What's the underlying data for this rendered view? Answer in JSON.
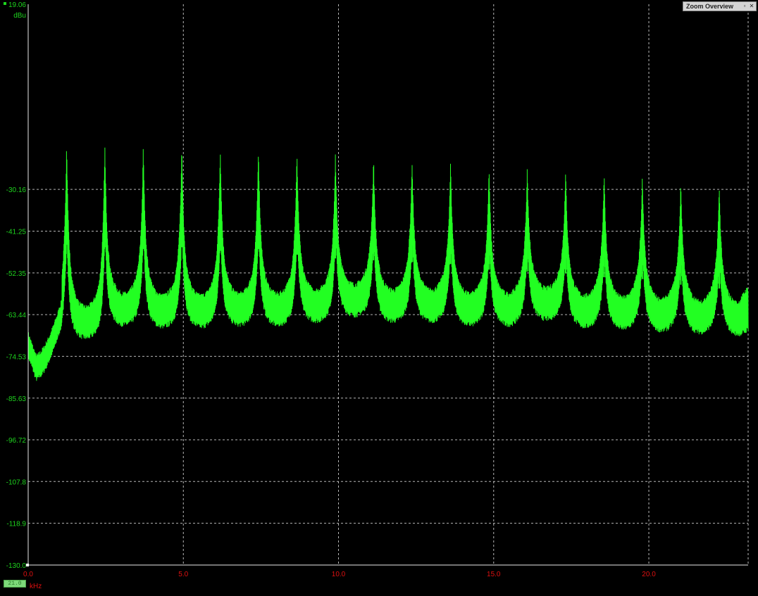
{
  "window": {
    "panel_title": "Zoom Overview",
    "restore_glyph": "▫",
    "close_glyph": "✕",
    "status_chip": "21.0"
  },
  "colors": {
    "background": "#000000",
    "trace": "#22ff22",
    "y_labels": "#1ed41e",
    "x_labels": "#e01010",
    "grid": "#d8d8d8"
  },
  "chart_data": {
    "type": "line",
    "title": "",
    "ylabel": "dBu",
    "xlabel": "kHz",
    "ylim": [
      -130.0,
      19.06
    ],
    "xlim": [
      0.0,
      23.2
    ],
    "y_ticks": [
      "19.06",
      "-30.16",
      "-41.25",
      "-52.35",
      "-63.44",
      "-74.53",
      "-85.63",
      "-96.72",
      "-107.8",
      "-118.9",
      "-130.0"
    ],
    "y_tick_values": [
      19.06,
      -30.16,
      -41.25,
      -52.35,
      -63.44,
      -74.53,
      -85.63,
      -96.72,
      -107.8,
      -118.9,
      -130.0
    ],
    "x_ticks": [
      "0.0",
      "5.0",
      "10.0",
      "15.0",
      "20.0"
    ],
    "x_tick_values": [
      0,
      5,
      10,
      15,
      20
    ],
    "grid": true,
    "series": [
      {
        "peaks_khz": [
          1.24,
          2.47,
          3.71,
          4.95,
          6.19,
          7.42,
          8.66,
          9.9,
          11.13,
          12.37,
          13.61,
          14.85,
          16.08,
          17.32,
          18.56,
          19.79,
          21.03,
          22.27
        ],
        "peaks_dbu": [
          -26.5,
          -27.5,
          -28.0,
          -27.5,
          -28.5,
          -28.0,
          -29.5,
          -30.5,
          -31.0,
          -31.5,
          -32.0,
          -33.5,
          -34.0,
          -34.5,
          -35.5,
          -36.0,
          -37.5,
          -38.5
        ],
        "troughs_dbu": [
          -71.5,
          -68.0,
          -68.5,
          -68.5,
          -68.0,
          -68.0,
          -67.0,
          -65.5,
          -67.0,
          -67.0,
          -68.0,
          -68.0,
          -66.5,
          -68.5,
          -69.0,
          -69.5,
          -70.0,
          -70.5
        ],
        "start_khz": 0.0,
        "start_dbu": -74.5,
        "floor_min_khz": 0.25,
        "floor_min_dbu": -80.5,
        "end_khz": 23.2,
        "end_dbu": -56.5
      }
    ]
  }
}
